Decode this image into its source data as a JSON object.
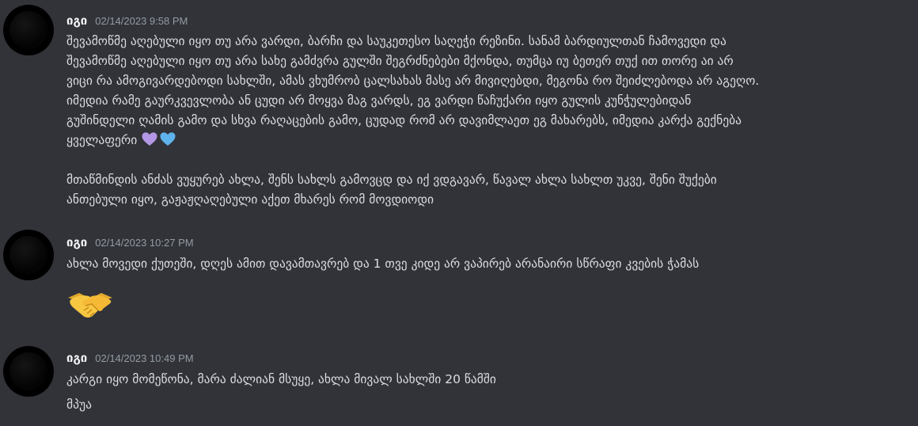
{
  "messages": [
    {
      "username": "იგი",
      "timestamp": "02/14/2023 9:58 PM",
      "lines": [
        "შევამოწმე აღებული იყო თუ არა ვარდი, ბარჩი და საუკეთესო საღეჭი რეზინი. სანამ  ბარდიულთან ჩამოვედი და",
        "შევამოწმე აღებული იყო თუ არა სახე გამძვრა  გულში შეგრძნებები მქონდა, თუმცა იუ ბეთერ თუქ ით თორე აი არ",
        "ვიცი რა ამოგივარდებოდი სახლში, ამას ვხუმრობ ცალსახას მასე არ მივიღებდი, მეგონა რო შეიძლებოდა არ აგეღო.",
        "იმედია რამე გაურკვევლობა ან ცუდი არ მოყვა მაგ ვარდს, ეგ ვარდი წაჩუქარი იყო გულის კუნჭულებიდან",
        "გუშინდელი ღამის გამო და სხვა რაღაცების გამო, ცუდად რომ არ დავიმლაეთ ეგ მახარებს, იმედია კარქა გექნება",
        "ყველაფერი",
        "მთაწმინდის ანძას ვუყურებ ახლა, შენს სახლს გამოვცდ და იქ ვდგავარ, წავალ ახლა სახლთ უკვე, შენი შუქები",
        "ანთებული იყო, გაჟაჟღაღებული აქეთ მხარეს რომ მოვდიოდი"
      ],
      "emojis": [
        "purple-heart",
        "blue-heart"
      ]
    },
    {
      "username": "იგი",
      "timestamp": "02/14/2023 10:27 PM",
      "lines": [
        "ახლა მოვედი ქუთეში, დღეს ამით დავამთავრებ და 1 თვე კიდე არ ვაპირებ არანაირი სწრაფი კვების ჭამას"
      ],
      "emojis": [
        "handshake"
      ]
    },
    {
      "username": "იგი",
      "timestamp": "02/14/2023 10:49 PM",
      "lines": [
        "კარგი იყო მომეწონა, მარა ძალიან მსუყე, ახლა მივალ სახლში 20 წამში",
        "მპუა"
      ]
    }
  ],
  "colors": {
    "background": "#313338",
    "username": "#f2f3f5",
    "timestamp": "#949ba4",
    "text": "#dbdee1",
    "purple_heart": "#b497e6",
    "blue_heart": "#5fb3ec",
    "handshake": "#f7c742"
  }
}
